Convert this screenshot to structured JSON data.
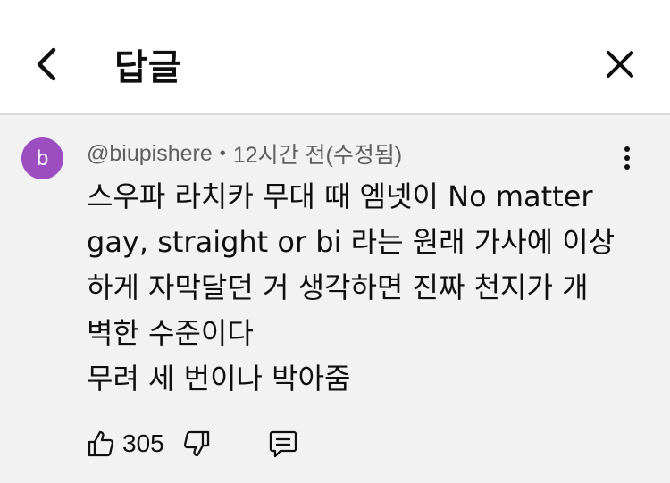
{
  "header": {
    "title": "답글",
    "back_icon": "chevron-left-icon",
    "close_icon": "close-icon"
  },
  "comment": {
    "avatar_letter": "b",
    "avatar_color": "#9c4dbf",
    "author": "@biupishere",
    "separator": "•",
    "time": "12시간 전(수정됨)",
    "lines": [
      "스우파 라치카 무대 때 엠넷이 No matter",
      "gay, straight or bi 라는 원래 가사에 이상",
      "하게 자막달던 거 생각하면 진짜 천지가 개",
      "벽한 수준이다",
      "무려 세 번이나 박아줌"
    ],
    "like_count": "305",
    "icons": [
      "thumbs-up-icon",
      "thumbs-down-icon",
      "reply-icon",
      "more-vert-icon"
    ]
  }
}
